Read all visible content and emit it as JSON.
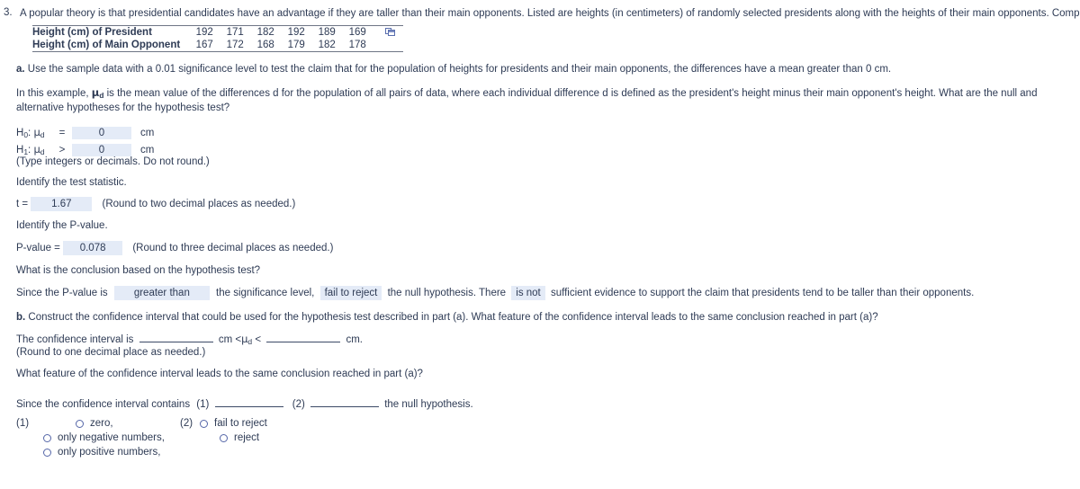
{
  "question": {
    "number": "3.",
    "intro": "A popular theory is that presidential candidates have an advantage if they are taller than their main opponents. Listed are heights (in centimeters) of randomly selected presidents along with the heights of their main opponents. Complete parts (a) and (b) below."
  },
  "table": {
    "row1_label": "Height (cm) of President",
    "row1_values": [
      "192",
      "171",
      "182",
      "192",
      "189",
      "169"
    ],
    "row2_label": "Height (cm) of Main Opponent",
    "row2_values": [
      "167",
      "172",
      "168",
      "179",
      "182",
      "178"
    ],
    "copy_icon": "copy-icon"
  },
  "part_a": {
    "prompt_bold": "a.",
    "prompt": " Use the sample data with a 0.01 significance level to test the claim that for the population of heights for presidents and their main opponents, the differences have a mean greater than 0 cm.",
    "explanation_pre": "In this example, ",
    "explanation_post": " is the mean value of the differences d for the population of all pairs of data, where each individual difference d is defined as the president's height minus their main opponent's height. What are the null and alternative hypotheses for the hypothesis test?",
    "h0_label": "H",
    "h0_sub": "0",
    "h0_mu": "μ",
    "h0_musub": "d",
    "h0_operator": "=",
    "h0_value": "0",
    "h0_unit": "cm",
    "h1_label": "H",
    "h1_sub": "1",
    "h1_mu": "μ",
    "h1_musub": "d",
    "h1_operator": ">",
    "h1_value": "0",
    "h1_unit": "cm",
    "hyp_note": "(Type integers or decimals. Do not round.)",
    "test_stat_prompt": "Identify the test statistic.",
    "test_stat_label": "t =",
    "test_stat_value": "1.67",
    "test_stat_note": "(Round to two decimal places as needed.)",
    "pvalue_prompt": "Identify the P-value.",
    "pvalue_label": "P-value =",
    "pvalue_value": "0.078",
    "pvalue_note": "(Round to three decimal places as needed.)",
    "conclusion_prompt": "What is the conclusion based on the hypothesis test?",
    "conclusion_pre": "Since the P-value is",
    "conclusion_choice1": "greater than",
    "conclusion_mid1": "the significance level,",
    "conclusion_choice2": "fail to reject",
    "conclusion_mid2": "the null hypothesis. There",
    "conclusion_choice3": "is not",
    "conclusion_end": "sufficient evidence to support the claim that presidents tend to be taller than their opponents."
  },
  "part_b": {
    "prompt_bold": "b.",
    "prompt": " Construct the confidence interval that could be used for the hypothesis test described in part (a). What feature of the confidence interval leads to the same conclusion reached in part (a)?",
    "ci_pre": "The confidence interval is",
    "ci_lower_value": "",
    "ci_mid_unit": "cm <",
    "ci_mu": "μ",
    "ci_musub": "d",
    "ci_lt": "<",
    "ci_upper_value": "",
    "ci_end_unit": "cm.",
    "ci_note": "(Round to one decimal place as needed.)",
    "feature_prompt": "What feature of the confidence interval leads to the same conclusion reached in part (a)?",
    "feature_pre": "Since the confidence interval contains",
    "blank1_label": "(1)",
    "blank1_value": "",
    "blank2_label": "(2)",
    "blank2_value": "",
    "feature_end": "the null hypothesis."
  },
  "choices": {
    "group1_label": "(1)",
    "group1_options": [
      "zero,",
      "only negative numbers,",
      "only positive numbers,"
    ],
    "group2_label": "(2)",
    "group2_options": [
      "fail to reject",
      "reject"
    ]
  },
  "colors": {
    "text": "#2e3b55",
    "field_bg": "#e4ebf7",
    "radio_outline": "#5566a8",
    "rule": "#6e7585"
  }
}
